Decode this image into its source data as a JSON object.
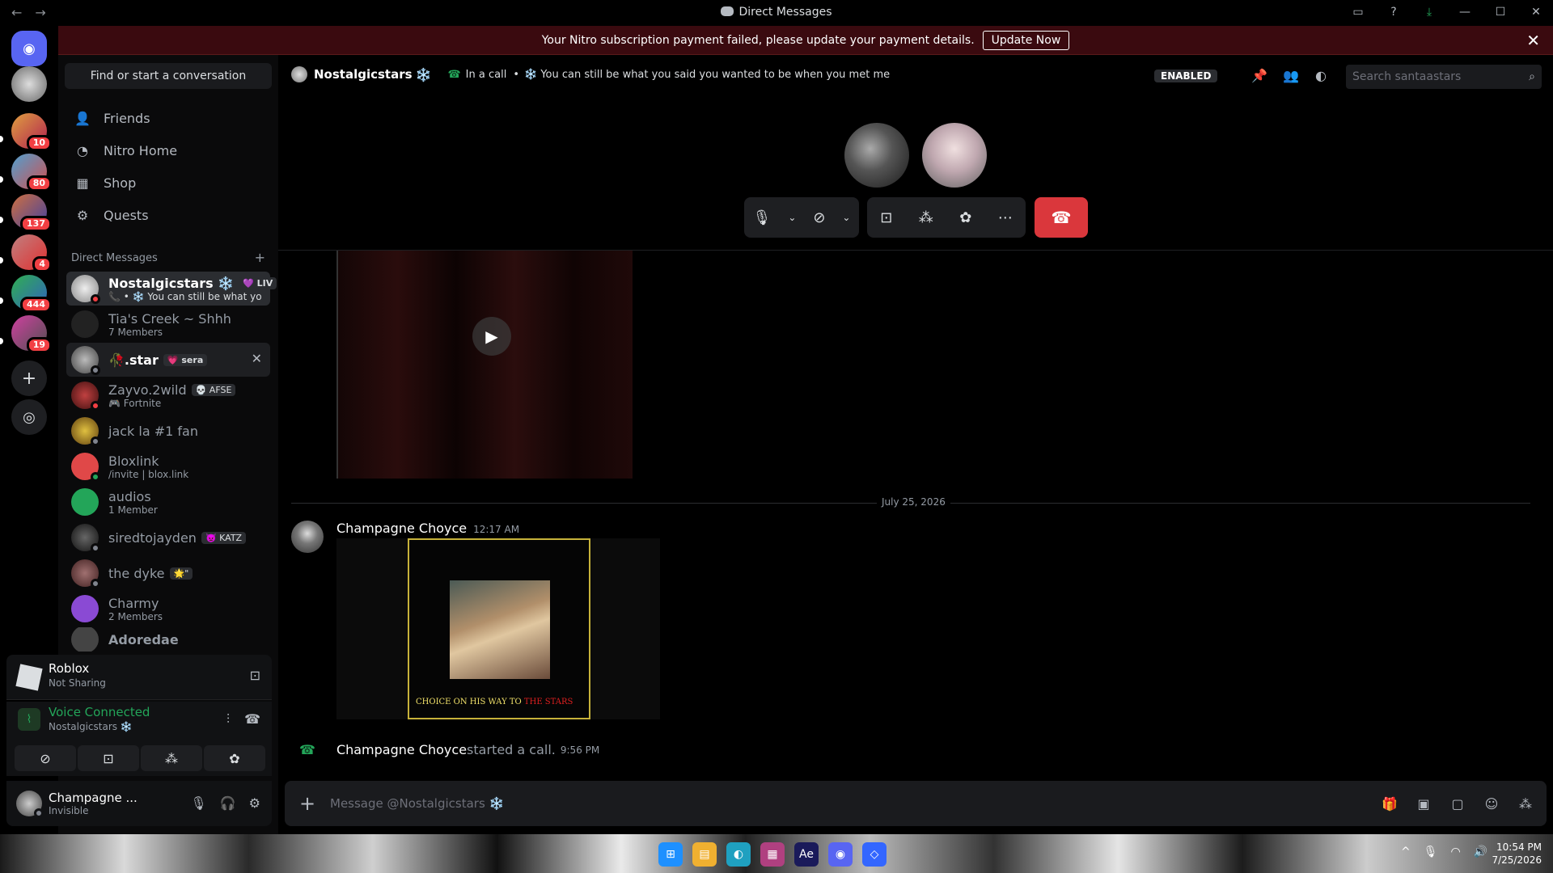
{
  "window": {
    "title": "Direct Messages",
    "back": "←",
    "forward": "→"
  },
  "banner": {
    "text": "Your Nitro subscription payment failed, please update your payment details.",
    "button": "Update Now",
    "close": "✕"
  },
  "sidebar": {
    "search": "Find or start a conversation",
    "nav": [
      {
        "label": "Friends",
        "icon": "friends-icon"
      },
      {
        "label": "Nitro Home",
        "icon": "nitro-icon"
      },
      {
        "label": "Shop",
        "icon": "shop-icon"
      },
      {
        "label": "Quests",
        "icon": "quests-icon"
      }
    ],
    "section": "Direct Messages",
    "section_add": "+",
    "dms": [
      {
        "name": "Nostalgicstars ❄️",
        "tag": "💜 LIV",
        "sub": "📞 • ❄️ You can still be what you sai...",
        "color": "#cfcfcf",
        "status": "#f23f43"
      },
      {
        "name": "Tia's Creek ~ Shhh",
        "sub": "7 Members",
        "color": "#222",
        "status": ""
      },
      {
        "name": "🥀.star",
        "tag": "💗 sera",
        "color": "#888",
        "status": "#80848e"
      },
      {
        "name": "Zayvo.2wild",
        "tag": "💀 AFSE",
        "sub": "🎮 Fortnite",
        "color": "#7a1e1e",
        "status": "#f23f43"
      },
      {
        "name": "jack la #1 fan",
        "color": "#b8860b",
        "status": "#80848e"
      },
      {
        "name": "Bloxlink",
        "sub": "/invite | blox.link",
        "color": "#e04848",
        "status": "#23a559"
      },
      {
        "name": "audios",
        "sub": "1 Member",
        "color": "#23a559",
        "status": ""
      },
      {
        "name": "siredtojayden",
        "tag": "👿 KATZ",
        "color": "#333",
        "status": "#80848e"
      },
      {
        "name": "the dyke",
        "tag": "🌟\"",
        "color": "#5a3a3a",
        "status": "#80848e"
      },
      {
        "name": "Charmy",
        "sub": "2 Members",
        "color": "#8a4ad4",
        "status": ""
      },
      {
        "name": "Adoredae",
        "color": "#444",
        "status": ""
      }
    ],
    "activity": {
      "title": "Roblox",
      "sub": "Not Sharing"
    },
    "voice": {
      "title": "Voice Connected",
      "sub": "Nostalgicstars ❄️"
    },
    "user": {
      "name": "Champagne ...",
      "status": "Invisible"
    }
  },
  "servers": {
    "badges": [
      "10",
      "80",
      "137",
      "4",
      "444",
      "19"
    ]
  },
  "header": {
    "name": "Nostalgicstars",
    "snow": "❄️",
    "call": "In a call",
    "status": "❄️ You can still be what you said you wanted to be when you met me",
    "enabled": "ENABLED",
    "search_placeholder": "Search santaastars"
  },
  "messages": {
    "date": "July 25, 2026",
    "author": "Champagne Choyce",
    "time": "12:17 AM",
    "poster_caption_a": "CHOICE ON HIS WAY TO",
    "poster_caption_b": "THE STARS",
    "system_author": "Champagne Choyce",
    "system_text": " started a call.",
    "system_time": "9:56 PM"
  },
  "composer": {
    "placeholder": "Message @Nostalgicstars ❄️"
  },
  "taskbar": {
    "time": "10:54 PM",
    "date": "7/25/2026"
  }
}
